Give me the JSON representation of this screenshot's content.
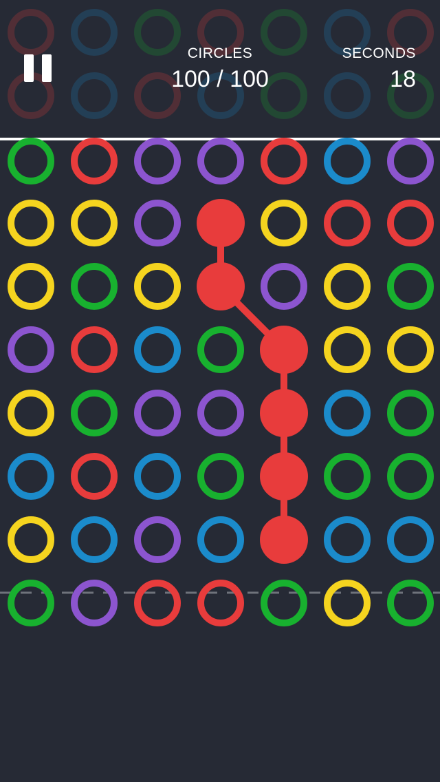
{
  "header": {
    "circles_label": "CIRCLES",
    "circles_value": "100 / 100",
    "seconds_label": "SECONDS",
    "seconds_value": "18",
    "pause_icon": "pause-icon"
  },
  "colors": {
    "background": "#262a35",
    "G": "#18b12f",
    "R": "#e83c3c",
    "P": "#8c55cf",
    "Y": "#f5d41f",
    "B": "#1b8bcb",
    "divider": "#ffffff",
    "dashed_line": "#6f737b"
  },
  "board": {
    "rows": [
      [
        "G",
        "R",
        "P",
        "P",
        "R",
        "B",
        "P"
      ],
      [
        "Y",
        "Y",
        "P",
        "R",
        "Y",
        "R",
        "R"
      ],
      [
        "Y",
        "G",
        "Y",
        "R",
        "P",
        "Y",
        "G"
      ],
      [
        "P",
        "R",
        "B",
        "G",
        "R",
        "Y",
        "Y"
      ],
      [
        "Y",
        "G",
        "P",
        "P",
        "R",
        "B",
        "G"
      ],
      [
        "B",
        "R",
        "B",
        "G",
        "R",
        "G",
        "G"
      ],
      [
        "Y",
        "B",
        "P",
        "B",
        "R",
        "B",
        "B"
      ],
      [
        "G",
        "P",
        "R",
        "R",
        "G",
        "Y",
        "G"
      ]
    ],
    "selected_color": "R",
    "selected_path": [
      [
        1,
        3
      ],
      [
        2,
        3
      ],
      [
        3,
        4
      ],
      [
        4,
        4
      ],
      [
        5,
        4
      ],
      [
        6,
        4
      ]
    ]
  },
  "header_background_rows": [
    [
      "R",
      "B",
      "G",
      "R",
      "G",
      "B",
      "R"
    ],
    [
      "R",
      "B",
      "R",
      "B",
      "G",
      "B",
      "G"
    ]
  ]
}
